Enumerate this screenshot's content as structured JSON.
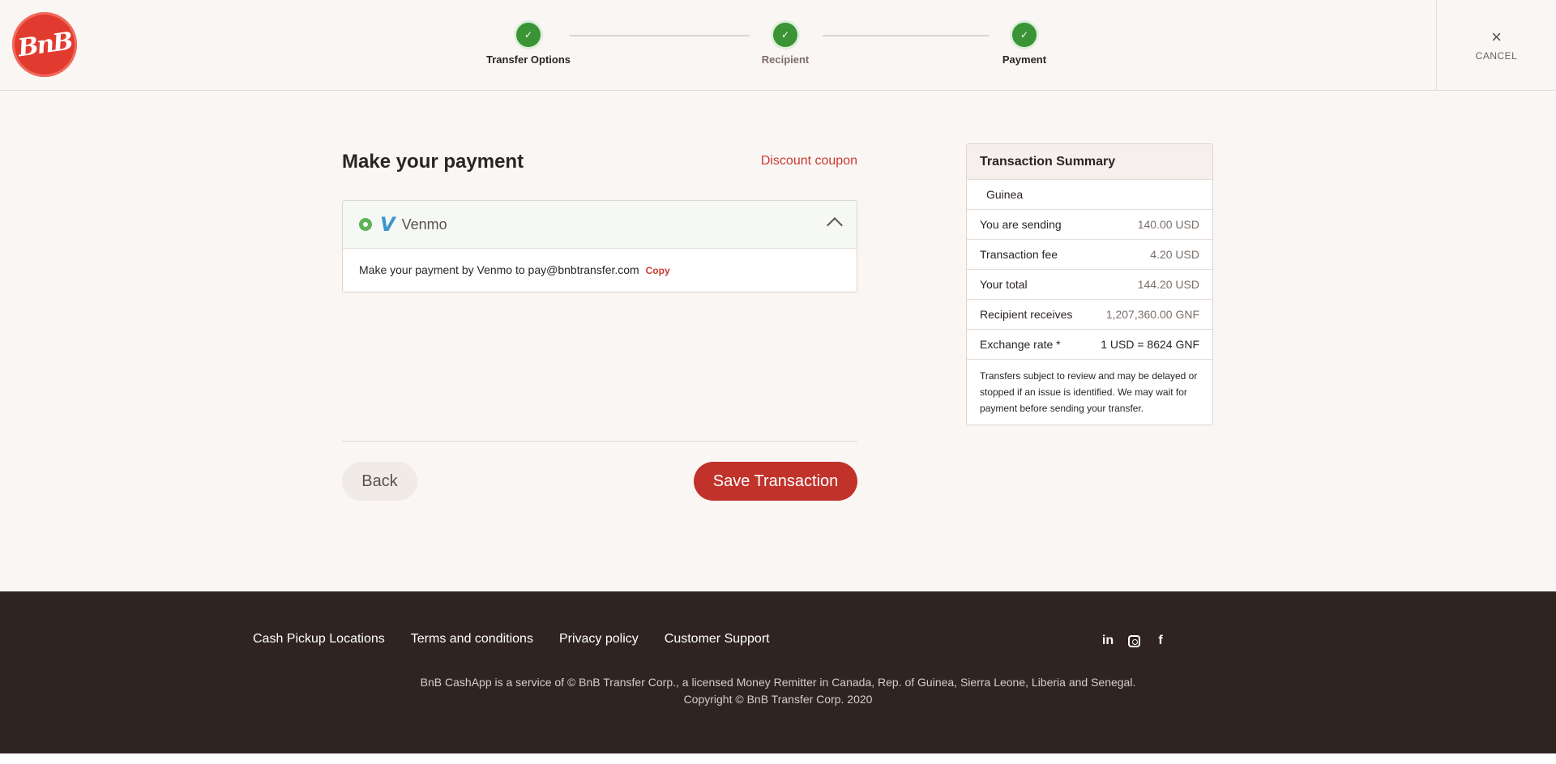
{
  "brand": {
    "logo_text": "BnB"
  },
  "steps": [
    {
      "label": "Transfer Options",
      "check": "✓"
    },
    {
      "label": "Recipient",
      "check": "✓"
    },
    {
      "label": "Payment",
      "check": "✓"
    }
  ],
  "header": {
    "cancel_label": "CANCEL",
    "cancel_icon": "×"
  },
  "payment": {
    "title": "Make your payment",
    "discount_link": "Discount coupon",
    "method_logo": "V",
    "method_name": "Venmo",
    "instruction": "Make your payment by Venmo to pay@bnbtransfer.com",
    "copy_label": "Copy"
  },
  "actions": {
    "back_label": "Back",
    "save_label": "Save Transaction"
  },
  "summary": {
    "title": "Transaction Summary",
    "country": "Guinea",
    "rows": [
      {
        "label": "You are sending",
        "value": "140.00 USD"
      },
      {
        "label": "Transaction fee",
        "value": "4.20 USD"
      },
      {
        "label": "Your total",
        "value": "144.20 USD"
      },
      {
        "label": "Recipient receives",
        "value": "1,207,360.00 GNF"
      },
      {
        "label": "Exchange rate *",
        "value": "1 USD = 8624 GNF"
      }
    ],
    "note": "Transfers subject to review and may be delayed or stopped if an issue is identified. We may wait for payment before sending your transfer."
  },
  "footer": {
    "links": [
      "Cash Pickup Locations",
      "Terms and conditions",
      "Privacy policy",
      "Customer Support"
    ],
    "social": {
      "linkedin": "in",
      "facebook": "f"
    },
    "legal_line1": "BnB CashApp is a service of © BnB Transfer Corp., a licensed Money Remitter in Canada, Rep. of Guinea, Sierra Leone, Liberia and Senegal.",
    "legal_line2": "Copyright © BnB Transfer Corp. 2020"
  },
  "colors": {
    "primary": "#c0322a",
    "step_done": "#3a9435",
    "footer_bg": "#2f2421",
    "venmo": "#3d95ce"
  }
}
